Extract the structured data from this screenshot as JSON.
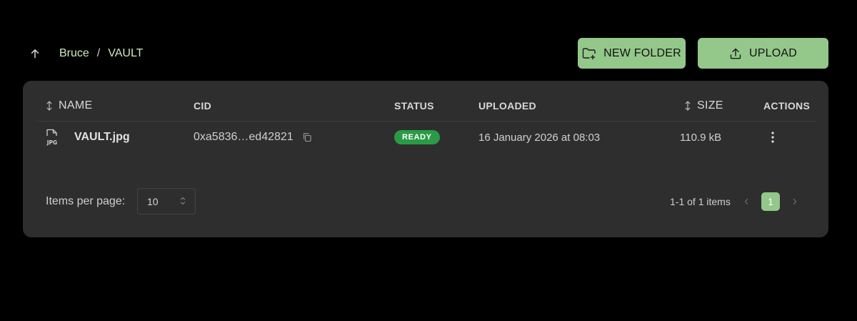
{
  "breadcrumb": {
    "items": [
      "Bruce"
    ],
    "separator": "/",
    "current": "VAULT"
  },
  "toolbar": {
    "new_folder_label": "NEW FOLDER",
    "upload_label": "UPLOAD"
  },
  "table": {
    "columns": {
      "name": "NAME",
      "cid": "CID",
      "status": "STATUS",
      "uploaded": "UPLOADED",
      "size": "SIZE",
      "actions": "ACTIONS"
    },
    "rows": [
      {
        "file_type": "JPG",
        "name": "VAULT.jpg",
        "cid": "0xa5836…ed42821",
        "status": "READY",
        "uploaded": "16 January 2026 at 08:03",
        "size": "110.9 kB"
      }
    ]
  },
  "pagination": {
    "items_per_page_label": "Items per page:",
    "items_per_page_value": "10",
    "range_text": "1-1 of 1 items",
    "current_page": "1"
  },
  "colors": {
    "accent": "#94c78a",
    "status_ready": "#2b9a46",
    "card_bg": "#2e2e2e",
    "page_bg": "#000000"
  },
  "icons": {
    "up": "arrow-up-icon",
    "new_folder": "folder-plus-icon",
    "upload": "upload-icon",
    "sort": "sort-icon",
    "file": "jpg-file-icon",
    "copy": "copy-icon",
    "kebab": "more-vertical-icon",
    "chevrons": "chevron-up-down-icon",
    "prev": "chevron-left-icon",
    "next": "chevron-right-icon"
  }
}
